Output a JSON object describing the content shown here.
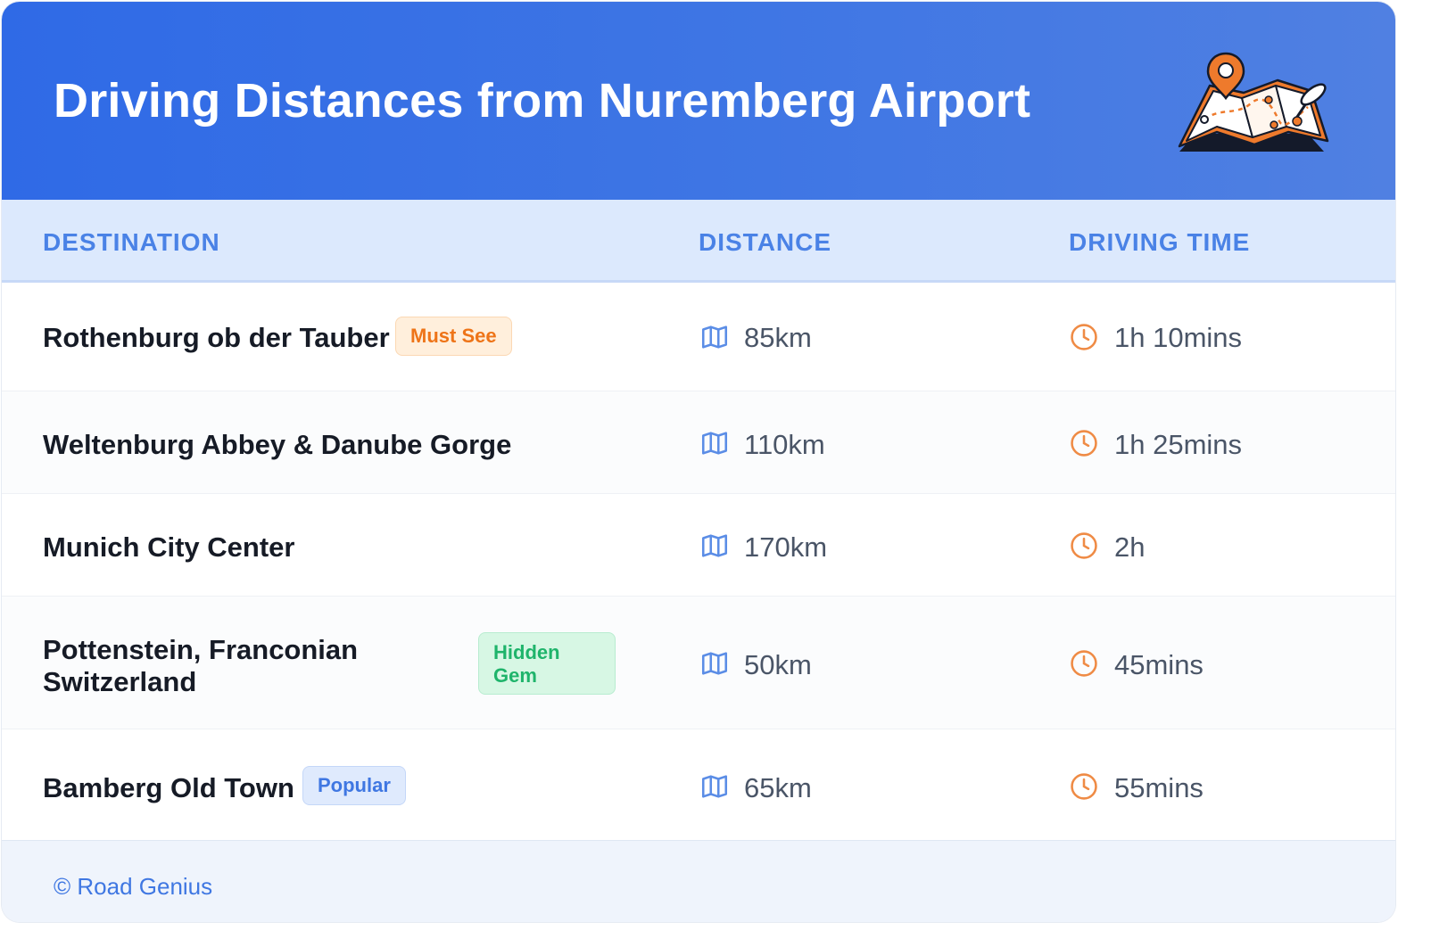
{
  "header": {
    "title": "Driving Distances from Nuremberg Airport",
    "illustration": "map-with-pin-icon"
  },
  "table": {
    "columns": [
      "DESTINATION",
      "DISTANCE",
      "DRIVING TIME"
    ],
    "rows": [
      {
        "destination": "Rothenburg ob der Tauber",
        "badge": "Must See",
        "distance": "85km",
        "time": "1h 10mins"
      },
      {
        "destination": "Weltenburg Abbey & Danube Gorge",
        "badge": "",
        "distance": "110km",
        "time": "1h 25mins"
      },
      {
        "destination": "Munich City Center",
        "badge": "",
        "distance": "170km",
        "time": "2h"
      },
      {
        "destination": "Pottenstein, Franconian Switzerland",
        "badge": "Hidden Gem",
        "distance": "50km",
        "time": "45mins"
      },
      {
        "destination": "Bamberg Old Town",
        "badge": "Popular",
        "distance": "65km",
        "time": "55mins"
      }
    ]
  },
  "footer": {
    "brand": "© Road Genius"
  },
  "colors": {
    "header_gradient_start": "#2f6ae6",
    "header_gradient_end": "#5080e2",
    "column_header_text": "#4a82e6",
    "distance_icon": "#5b8de6",
    "time_icon": "#ef8b45",
    "badge_must_see": "#ee7418",
    "badge_hidden_gem": "#1fb46b",
    "badge_popular": "#3f77e2"
  },
  "icons": {
    "distance": "map-icon",
    "time": "clock-icon"
  }
}
